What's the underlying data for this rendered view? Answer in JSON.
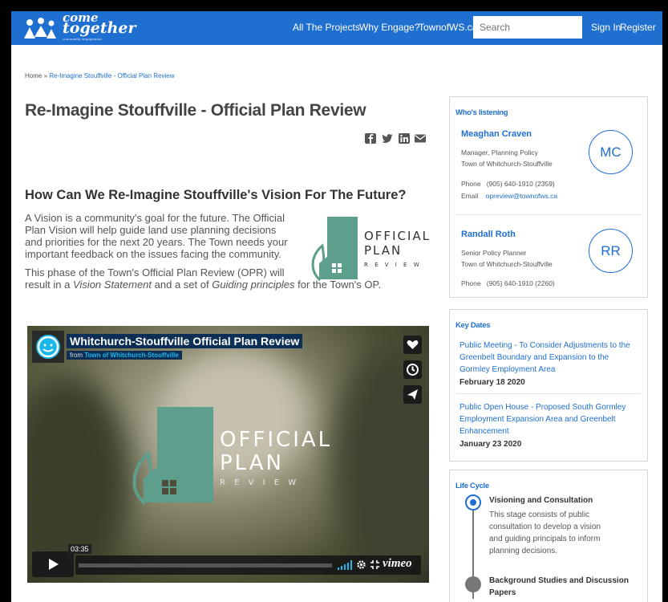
{
  "header": {
    "logo_line1": "come",
    "logo_line2": "together",
    "logo_tagline": "community engagement",
    "nav": [
      "All The Projects",
      "Why Engage?",
      "TownofWS.ca"
    ],
    "search_placeholder": "Search",
    "signin": "Sign In",
    "register": "Register",
    "brand_color": "#1f6fd1"
  },
  "breadcrumb": {
    "home": "Home",
    "sep": "»",
    "current": "Re-Imagine Stouffville - Official Plan Review"
  },
  "page": {
    "title": "Re-Imagine Stouffville - Official Plan Review",
    "share_icons": [
      "facebook-icon",
      "twitter-icon",
      "linkedin-icon",
      "email-icon"
    ],
    "heading": "How Can We Re-Imagine Stouffville's Vision For The Future?",
    "para1_lines": [
      "A Vision is a community's goal for the future. The Official",
      "Plan Vision will help guide land use planning decisions",
      "and priorities for the next 20 years. The Town needs your",
      "important feedback on the issues facing the community."
    ],
    "para2_line1": "This phase of the Town's Official Plan Review (OPR) will",
    "para2_line2_pre": "result in a ",
    "para2_line2_em1": "Vision Statement",
    "para2_line2_mid": " and a set of ",
    "para2_line2_em2": "Guiding principles",
    "para2_line2_post": " for the Town's OP.",
    "logo_words": [
      "OFFICIAL",
      "PLAN",
      "R E V I E W"
    ],
    "logo_color": "#5e9e8c"
  },
  "video": {
    "title": "Whitchurch-Stouffville Official Plan Review",
    "from_label": "from",
    "from_channel": "Town of Whitchurch-Stouffville",
    "time": "03:35",
    "brand": "vimeo",
    "logo_words": [
      "OFFICIAL",
      "PLAN",
      "R  E  V  I  E  W"
    ]
  },
  "sidebar": {
    "listening": {
      "heading": "Who's listening",
      "people": [
        {
          "name": "Meaghan Craven",
          "role": "Manager, Planning Policy",
          "org": "Town of Whitchurch-Stouffville",
          "phone_label": "Phone",
          "phone": "(905) 640-1910 (2359)",
          "email_label": "Email",
          "email": "opreview@townofws.ca",
          "initials": "MC"
        },
        {
          "name": "Randall Roth",
          "role": "Senior Policy Planner",
          "org": "Town of Whitchurch-Stouffville",
          "phone_label": "Phone",
          "phone": "(905) 640-1910 (2260)",
          "initials": "RR"
        }
      ]
    },
    "key_dates": {
      "heading": "Key Dates",
      "items": [
        {
          "lines": [
            "Public Meeting - To Consider Adjustments to the",
            "Greenbelt Boundary and Expansion to the",
            "Gormley Employment Area"
          ],
          "date": "February 18 2020"
        },
        {
          "lines": [
            "Public Open House - Proposed South Gormley",
            "Employment Expansion Area and Greenbelt",
            "Enhancement"
          ],
          "date": "January 23 2020"
        }
      ]
    },
    "life_cycle": {
      "heading": "Life Cycle",
      "stages": [
        {
          "title": "Visioning and Consultation",
          "desc_lines": [
            "This stage consists of public",
            "consultation to develop a vision",
            "and guiding principals to inform",
            "planning decisions."
          ]
        },
        {
          "title_lines": [
            "Background Studies and Discussion",
            "Papers"
          ]
        }
      ]
    }
  }
}
